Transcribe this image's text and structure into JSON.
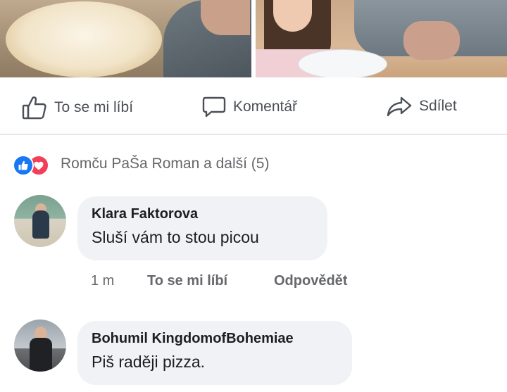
{
  "post": {
    "actions": {
      "like_label": "To se mi líbí",
      "comment_label": "Komentář",
      "share_label": "Sdílet"
    },
    "reactions": {
      "summary": "Romču PaŠa Roman a další (5)",
      "types": [
        "like-icon",
        "love-icon"
      ],
      "like_color": "#1877f2",
      "love_color": "#f33e58"
    }
  },
  "comments": [
    {
      "author": "Klara Faktorova",
      "text": "Sluší vám to stou picou",
      "time": "1 m",
      "like_label": "To se mi líbí",
      "reply_label": "Odpovědět"
    },
    {
      "author": "Bohumil KingdomofBohemiae",
      "text": "Piš raději pizza."
    }
  ],
  "colors": {
    "bubble": "#f0f2f5",
    "secondary_text": "#65676b"
  }
}
